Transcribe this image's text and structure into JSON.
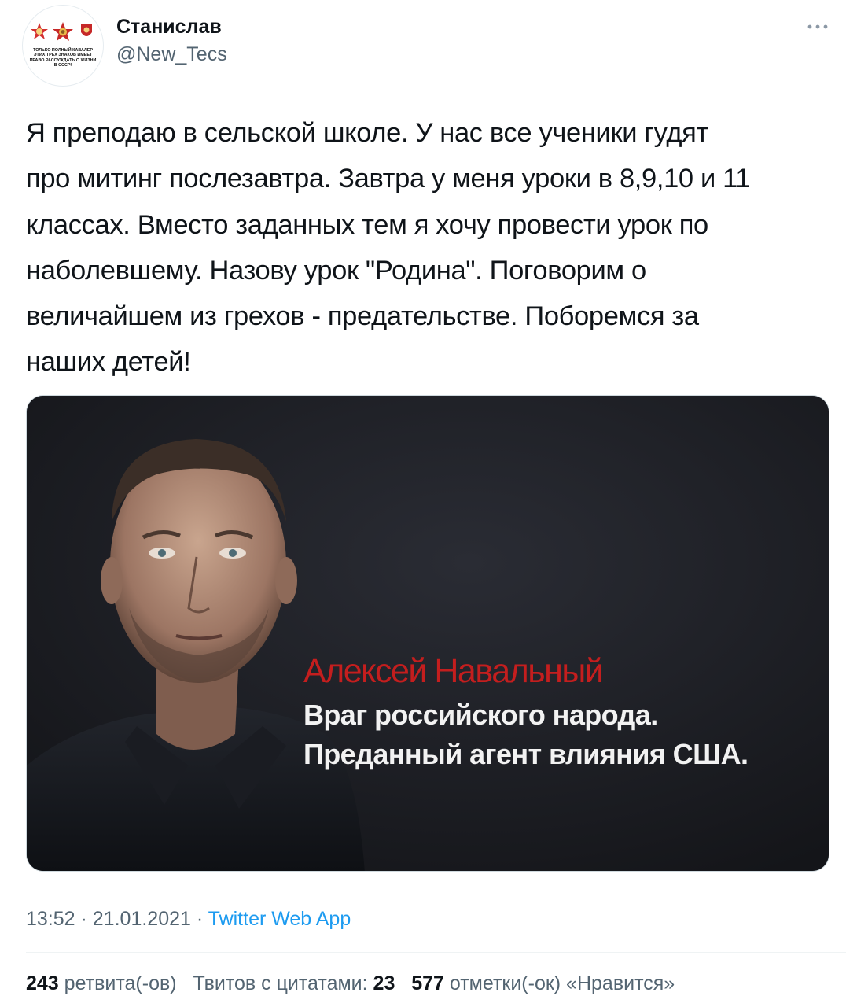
{
  "header": {
    "display_name": "Станислав",
    "handle": "@New_Tecs",
    "avatar_caption": "ТОЛЬКО ПОЛНЫЙ КАВАЛЕР ЭТИХ ТРЕХ ЗНАКОВ ИМЕЕТ ПРАВО РАССУЖДАТЬ О ЖИЗНИ В СССР!",
    "more_icon": "more-horizontal-icon"
  },
  "tweet": {
    "text": "Я преподаю в сельской школе. У нас все ученики гудят\nпро митинг послезавтра. Завтра у меня уроки в 8,9,10 и 11\nклассах. Вместо заданных тем я хочу провести урок по\nнаболевшему. Назову урок \"Родина\". Поговорим о\nвеличайшем из грехов - предательстве. Поборемся за\nнаших детей!"
  },
  "media": {
    "name": "Алексей Навальный",
    "line1": "Враг российского народа.",
    "line2": "Преданный агент влияния США."
  },
  "meta": {
    "time": "13:52",
    "sep1": " · ",
    "date": "21.01.2021",
    "sep2": " · ",
    "source": "Twitter Web App"
  },
  "stats": {
    "retweets_count": "243",
    "retweets_label": "ретвита(-ов)",
    "quotes_label": "Твитов с цитатами:",
    "quotes_count": "23",
    "likes_count": "577",
    "likes_label": "отметки(-ок) «Нравится»"
  },
  "colors": {
    "text": "#0f1419",
    "secondary": "#536471",
    "link": "#1d9bf0",
    "media_name": "#c41e1e"
  }
}
